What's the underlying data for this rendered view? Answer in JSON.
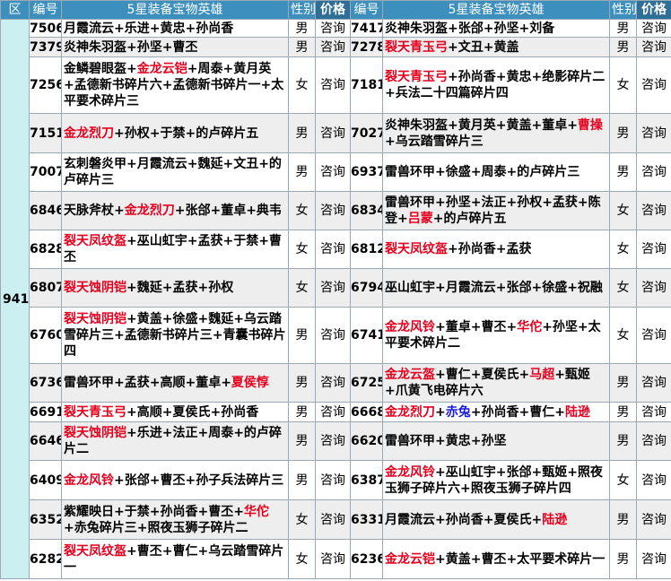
{
  "header": {
    "region": "区",
    "id": "编号",
    "equip": "5星装备宝物英雄",
    "sex": "性别",
    "price": "价格"
  },
  "region_value": "941",
  "colors": {
    "header": "#3d8fbe",
    "region": "#cceff1",
    "highlight_red": "#e6001e",
    "highlight_blue": "#1a1ae6"
  },
  "rows": [
    {
      "h": 20,
      "l": {
        "id": "7506",
        "sex": "男",
        "price": "咨询",
        "parts": [
          {
            "t": "月霞流云+乐进+黄忠+孙尚香"
          }
        ]
      },
      "r": {
        "id": "7417",
        "sex": "男",
        "price": "咨询",
        "parts": [
          {
            "t": "炎神朱羽盔+张郃+孙坚+刘备"
          }
        ]
      }
    },
    {
      "h": 22,
      "l": {
        "id": "7379",
        "sex": "男",
        "price": "咨询",
        "parts": [
          {
            "t": "炎神朱羽盔+孙坚+曹丕"
          }
        ]
      },
      "r": {
        "id": "7278",
        "sex": "男",
        "price": "咨询",
        "parts": [
          {
            "t": "裂天青玉弓",
            "c": "red"
          },
          {
            "t": "+文丑+黄盖"
          }
        ]
      }
    },
    {
      "h": 63,
      "l": {
        "id": "7256",
        "sex": "女",
        "price": "咨询",
        "parts": [
          {
            "t": "金鳞碧眼盔+"
          },
          {
            "t": "金龙云铠",
            "c": "red"
          },
          {
            "t": "+周泰+黄月英+孟德新书碎片六+孟德新书碎片一+太平要术碎片三"
          }
        ]
      },
      "r": {
        "id": "7181",
        "sex": "女",
        "price": "咨询",
        "parts": [
          {
            "t": "裂天青玉弓",
            "c": "red"
          },
          {
            "t": "+孙尚香+黄忠+绝影碎片二+兵法二十四篇碎片四"
          }
        ]
      }
    },
    {
      "h": 44,
      "l": {
        "id": "7151",
        "sex": "男",
        "price": "咨询",
        "parts": [
          {
            "t": "金龙烈刀",
            "c": "red"
          },
          {
            "t": "+孙权+于禁+的卢碎片五"
          }
        ]
      },
      "r": {
        "id": "7027",
        "sex": "男",
        "price": "咨询",
        "parts": [
          {
            "t": "炎神朱羽盔+黄月英+黄盖+董卓+"
          },
          {
            "t": "曹操",
            "c": "red"
          },
          {
            "t": "+乌云踏雪碎片三"
          }
        ]
      }
    },
    {
      "h": 43,
      "l": {
        "id": "7007",
        "sex": "男",
        "price": "咨询",
        "parts": [
          {
            "t": "玄刺磐炎甲+月霞流云+魏延+文丑+的卢碎片三"
          }
        ]
      },
      "r": {
        "id": "6937",
        "sex": "男",
        "price": "咨询",
        "parts": [
          {
            "t": "雷兽环甲+徐盛+周泰+的卢碎片三"
          }
        ]
      }
    },
    {
      "h": 43,
      "l": {
        "id": "6846",
        "sex": "女",
        "price": "咨询",
        "parts": [
          {
            "t": "天脉斧杖+"
          },
          {
            "t": "金龙烈刀",
            "c": "red"
          },
          {
            "t": "+张郃+董卓+典韦"
          }
        ]
      },
      "r": {
        "id": "6834",
        "sex": "女",
        "price": "咨询",
        "parts": [
          {
            "t": "雷兽环甲+孙坚+法正+孙权+孟获+陈登+"
          },
          {
            "t": "吕蒙",
            "c": "red"
          },
          {
            "t": "+的卢碎片五"
          }
        ]
      }
    },
    {
      "h": 43,
      "l": {
        "id": "6828",
        "sex": "女",
        "price": "咨询",
        "parts": [
          {
            "t": "裂天凤纹盔",
            "c": "red"
          },
          {
            "t": "+巫山虹宇+孟获+于禁+曹丕"
          }
        ]
      },
      "r": {
        "id": "6812",
        "sex": "女",
        "price": "咨询",
        "parts": [
          {
            "t": "裂天凤纹盔",
            "c": "red"
          },
          {
            "t": "+孙尚香+孟获"
          }
        ]
      }
    },
    {
      "h": 43,
      "l": {
        "id": "6807",
        "sex": "女",
        "price": "咨询",
        "parts": [
          {
            "t": "裂天蚀阴铠",
            "c": "red"
          },
          {
            "t": "+魏延+孟获+孙权"
          }
        ]
      },
      "r": {
        "id": "6794",
        "sex": "女",
        "price": "咨询",
        "parts": [
          {
            "t": "巫山虹宇+月霞流云+张郃+徐盛+祝融"
          }
        ]
      }
    },
    {
      "h": 63,
      "l": {
        "id": "6760",
        "sex": "男",
        "price": "咨询",
        "parts": [
          {
            "t": "裂天蚀阴铠",
            "c": "red"
          },
          {
            "t": "+黄盖+徐盛+魏延+乌云踏雪碎片三+孟德新书碎片三+青囊书碎片四"
          }
        ]
      },
      "r": {
        "id": "6741",
        "sex": "女",
        "price": "咨询",
        "parts": [
          {
            "t": "金龙风铃",
            "c": "red"
          },
          {
            "t": "+董卓+曹丕+"
          },
          {
            "t": "华佗",
            "c": "red"
          },
          {
            "t": "+孙坚+太平要术碎片二"
          }
        ]
      }
    },
    {
      "h": 43,
      "l": {
        "id": "6736",
        "sex": "男",
        "price": "咨询",
        "parts": [
          {
            "t": "雷兽环甲+孟获+高顺+董卓+"
          },
          {
            "t": "夏侯惇",
            "c": "red"
          }
        ]
      },
      "r": {
        "id": "6725",
        "sex": "男",
        "price": "咨询",
        "parts": [
          {
            "t": "金龙云盔",
            "c": "red"
          },
          {
            "t": "+曹仁+夏侯氏+"
          },
          {
            "t": "马超",
            "c": "red"
          },
          {
            "t": "+甄姬+爪黄飞电碎片六"
          }
        ]
      }
    },
    {
      "h": 22,
      "l": {
        "id": "6691",
        "sex": "男",
        "price": "咨询",
        "parts": [
          {
            "t": "裂天青玉弓",
            "c": "red"
          },
          {
            "t": "+高顺+夏侯氏+孙尚香"
          }
        ]
      },
      "r": {
        "id": "6668",
        "sex": "男",
        "price": "咨询",
        "parts": [
          {
            "t": "金龙烈刀",
            "c": "red"
          },
          {
            "t": "+"
          },
          {
            "t": "赤兔",
            "c": "blue"
          },
          {
            "t": "+孙尚香+曹仁+"
          },
          {
            "t": "陆逊",
            "c": "red"
          }
        ]
      }
    },
    {
      "h": 43,
      "l": {
        "id": "6646",
        "sex": "男",
        "price": "咨询",
        "parts": [
          {
            "t": "裂天蚀阴铠",
            "c": "red"
          },
          {
            "t": "+乐进+法正+周泰+的卢碎片二"
          }
        ]
      },
      "r": {
        "id": "6620",
        "sex": "男",
        "price": "咨询",
        "parts": [
          {
            "t": "雷兽环甲+黄忠+孙坚"
          }
        ]
      }
    },
    {
      "h": 44,
      "l": {
        "id": "6409",
        "sex": "男",
        "price": "咨询",
        "parts": [
          {
            "t": "金龙风铃",
            "c": "red"
          },
          {
            "t": "+张郃+曹丕+孙子兵法碎片三"
          }
        ]
      },
      "r": {
        "id": "6387",
        "sex": "女",
        "price": "咨询",
        "parts": [
          {
            "t": "金龙风铃",
            "c": "red"
          },
          {
            "t": "+巫山虹宇+张郃+甄姬+照夜玉狮子碎片六+照夜玉狮子碎片四"
          }
        ]
      }
    },
    {
      "h": 44,
      "l": {
        "id": "6352",
        "sex": "女",
        "price": "咨询",
        "parts": [
          {
            "t": "紫耀映日+于禁+孙尚香+曹丕+"
          },
          {
            "t": "华佗",
            "c": "red"
          },
          {
            "t": "+赤兔碎片三+照夜玉狮子碎片二"
          }
        ]
      },
      "r": {
        "id": "6331",
        "sex": "男",
        "price": "咨询",
        "parts": [
          {
            "t": "月霞流云+孙尚香+夏侯氏+"
          },
          {
            "t": "陆逊",
            "c": "red"
          }
        ]
      }
    },
    {
      "h": 44,
      "l": {
        "id": "6282",
        "sex": "女",
        "price": "咨询",
        "parts": [
          {
            "t": "裂天凤纹盔",
            "c": "red"
          },
          {
            "t": "+曹丕+曹仁+乌云踏雪碎片一"
          }
        ]
      },
      "r": {
        "id": "6236",
        "sex": "男",
        "price": "咨询",
        "parts": [
          {
            "t": "金龙云铠",
            "c": "red"
          },
          {
            "t": "+黄盖+曹丕+太平要术碎片一"
          }
        ]
      }
    }
  ]
}
